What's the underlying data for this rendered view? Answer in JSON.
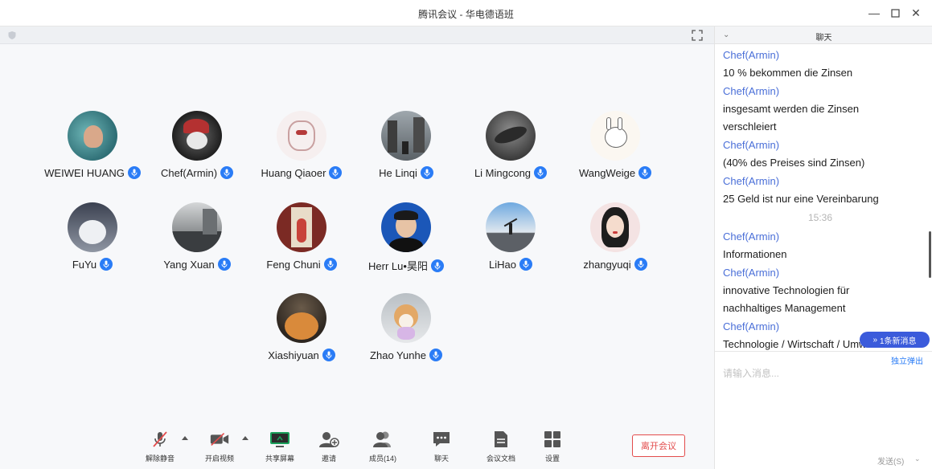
{
  "window": {
    "title": "腾讯会议 - 华电德语班"
  },
  "participants": [
    {
      "name": "WEIWEI HUANG",
      "avatar": "teal"
    },
    {
      "name": "Chef(Armin)",
      "avatar": "dark-host"
    },
    {
      "name": "Huang Qiaoer",
      "avatar": "sketch"
    },
    {
      "name": "He Linqi",
      "avatar": "city"
    },
    {
      "name": "Li Mingcong",
      "avatar": "dragon"
    },
    {
      "name": "WangWeige",
      "avatar": "bunny"
    },
    {
      "name": "FuYu",
      "avatar": "cat-snow"
    },
    {
      "name": "Yang Xuan",
      "avatar": "street"
    },
    {
      "name": "Feng Chuni",
      "avatar": "door"
    },
    {
      "name": "Herr Lu•昊阳",
      "avatar": "boy"
    },
    {
      "name": "LiHao",
      "avatar": "sky"
    },
    {
      "name": "zhangyuqi",
      "avatar": "girl"
    },
    {
      "name": "Xiashiyuan",
      "avatar": "orange-cat"
    },
    {
      "name": "Zhao Yunhe",
      "avatar": "dog"
    }
  ],
  "toolbar": {
    "unmute": "解除静音",
    "start_video": "开启视频",
    "share_screen": "共享屏幕",
    "invite": "邀请",
    "members": "成员(14)",
    "chat": "聊天",
    "docs": "会议文档",
    "settings": "设置",
    "leave": "离开会议"
  },
  "chat": {
    "title": "聊天",
    "messages": [
      {
        "sender": "Chef(Armin)",
        "lines": [
          "10 % bekommen die Zinsen"
        ]
      },
      {
        "sender": "Chef(Armin)",
        "lines": [
          "insgesamt werden die Zinsen",
          "verschleiert"
        ]
      },
      {
        "sender": "Chef(Armin)",
        "lines": [
          "(40% des Preises sind Zinsen)"
        ]
      },
      {
        "sender": "Chef(Armin)",
        "lines": [
          "25 Geld ist nur eine Vereinbarung"
        ]
      },
      {
        "timestamp": "15:36"
      },
      {
        "sender": "Chef(Armin)",
        "lines": [
          "Informationen"
        ]
      },
      {
        "sender": "Chef(Armin)",
        "lines": [
          "innovative Technologien für",
          "nachhaltiges Management"
        ]
      },
      {
        "sender": "Chef(Armin)",
        "lines": [
          "Technologie / Wirtschaft / Umwelt"
        ]
      }
    ],
    "new_messages": "1条新消息",
    "popout": "独立弹出",
    "input_placeholder": "请输入消息...",
    "send": "发送(S)"
  },
  "colors": {
    "accent": "#2a7cf6",
    "sender": "#4a6fd8",
    "leave": "#e34c4c",
    "new_badge": "#3b5bdb"
  }
}
